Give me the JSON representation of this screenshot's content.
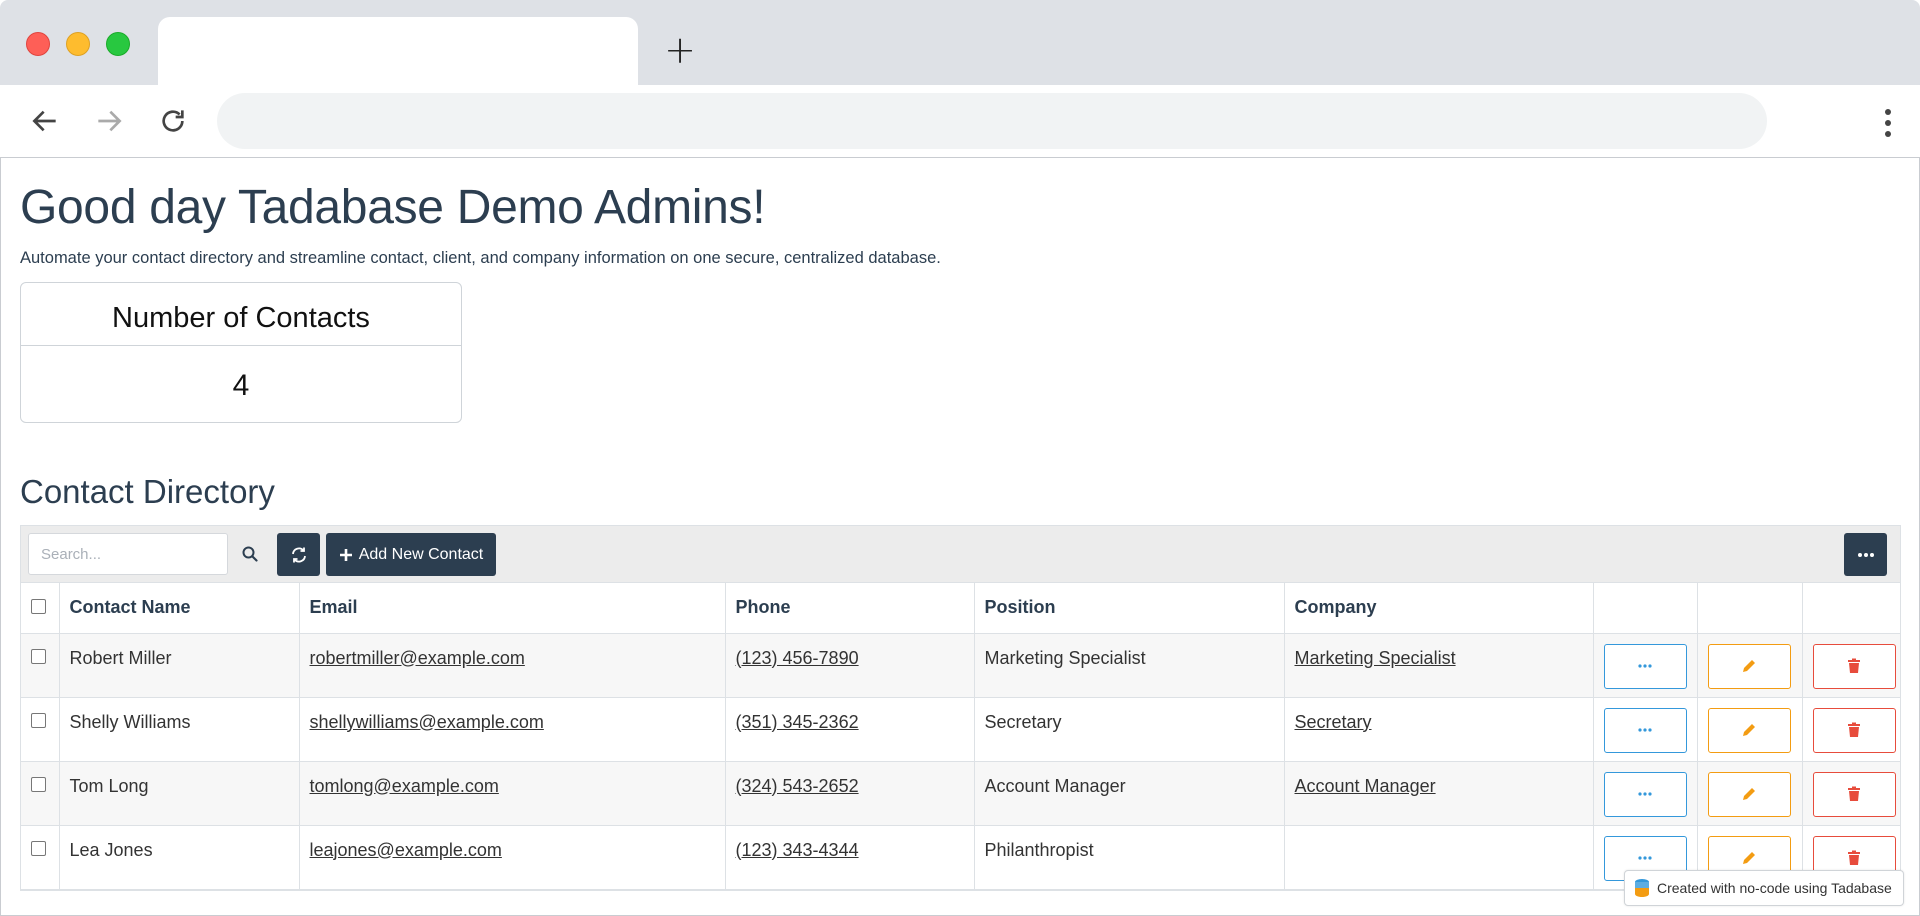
{
  "browser": {
    "new_tab_glyph": "+"
  },
  "page": {
    "greeting": "Good day Tadabase Demo Admins!",
    "subtitle": "Automate your contact directory and streamline contact, client, and company information on one secure, centralized database.",
    "stat": {
      "title": "Number of Contacts",
      "value": "4"
    },
    "section_title": "Contact Directory"
  },
  "toolbar": {
    "search_placeholder": "Search...",
    "add_label": "Add New Contact"
  },
  "table": {
    "columns": [
      "Contact Name",
      "Email",
      "Phone",
      "Position",
      "Company"
    ],
    "rows": [
      {
        "name": "Robert Miller",
        "email": "robertmiller@example.com",
        "phone": "(123) 456-7890",
        "position": "Marketing Specialist",
        "company": "Marketing Specialist"
      },
      {
        "name": "Shelly Williams",
        "email": "shellywilliams@example.com",
        "phone": "(351) 345-2362",
        "position": "Secretary",
        "company": "Secretary"
      },
      {
        "name": "Tom Long",
        "email": "tomlong@example.com",
        "phone": "(324) 543-2652",
        "position": "Account Manager",
        "company": "Account Manager"
      },
      {
        "name": "Lea Jones",
        "email": "leajones@example.com",
        "phone": "(123) 343-4344",
        "position": "Philanthropist",
        "company": ""
      }
    ]
  },
  "badge": {
    "text": "Created with no-code using Tadabase"
  },
  "colors": {
    "primary_dark": "#2c3e50",
    "view_accent": "#3498db",
    "edit_accent": "#f39c12",
    "delete_accent": "#e74c3c"
  },
  "icons": [
    "back-arrow-icon",
    "forward-arrow-icon",
    "reload-icon",
    "kebab-menu-icon",
    "search-icon",
    "refresh-icon",
    "plus-icon",
    "ellipsis-icon",
    "pencil-icon",
    "trash-icon",
    "database-icon"
  ]
}
